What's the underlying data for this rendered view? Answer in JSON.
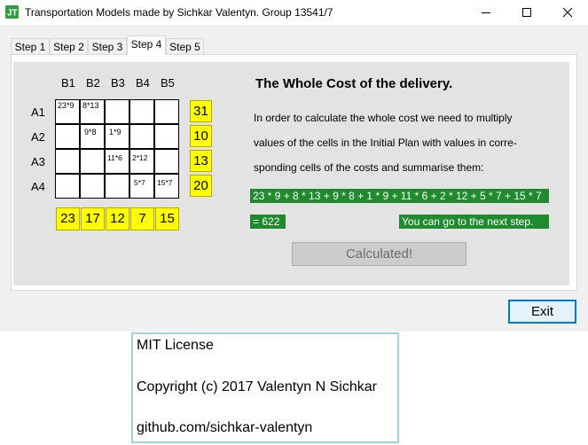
{
  "window": {
    "title": "Transportation Models made by Sichkar Valentyn. Group 13541/7",
    "icon": "jt-app-icon"
  },
  "tabs": [
    {
      "label": "Step 1",
      "active": false
    },
    {
      "label": "Step 2",
      "active": false
    },
    {
      "label": "Step 3",
      "active": false
    },
    {
      "label": "Step 4",
      "active": true
    },
    {
      "label": "Step 5",
      "active": false
    }
  ],
  "table": {
    "columns": [
      "B1",
      "B2",
      "B3",
      "B4",
      "B5"
    ],
    "rows": [
      "A1",
      "A2",
      "A3",
      "A4"
    ],
    "cells": [
      [
        "23*9",
        "8*13",
        "",
        "",
        ""
      ],
      [
        "",
        "9*8",
        "1*9",
        "",
        ""
      ],
      [
        "",
        "",
        "11*6",
        "2*12",
        ""
      ],
      [
        "",
        "",
        "",
        "5*7",
        "15*7"
      ]
    ],
    "supply": [
      "31",
      "10",
      "13",
      "20"
    ],
    "demand": [
      "23",
      "17",
      "12",
      "7",
      "15"
    ]
  },
  "content": {
    "heading": "The Whole Cost of the delivery.",
    "desc_line1": "In order to calculate the whole cost we need to multiply",
    "desc_line2": "values of the cells in the Initial Plan with values in corre-",
    "desc_line3": "sponding cells of the costs and summarise them:",
    "formula": "23 * 9 + 8 * 13 + 9 * 8 + 1 * 9 + 11 * 6 + 2 * 12 + 5 * 7 + 15 * 7",
    "result": "= 622",
    "next_message": "You can go to the next step.",
    "calculate_button": "Calculated!"
  },
  "exit_button": "Exit",
  "license": {
    "line1": "MIT License",
    "line2": "Copyright (c) 2017 Valentyn N Sichkar",
    "line3": "github.com/sichkar-valentyn"
  },
  "colors": {
    "accent_green": "#1f8a2e",
    "highlight_yellow": "#ffff00",
    "focus_blue": "#0078d7"
  }
}
